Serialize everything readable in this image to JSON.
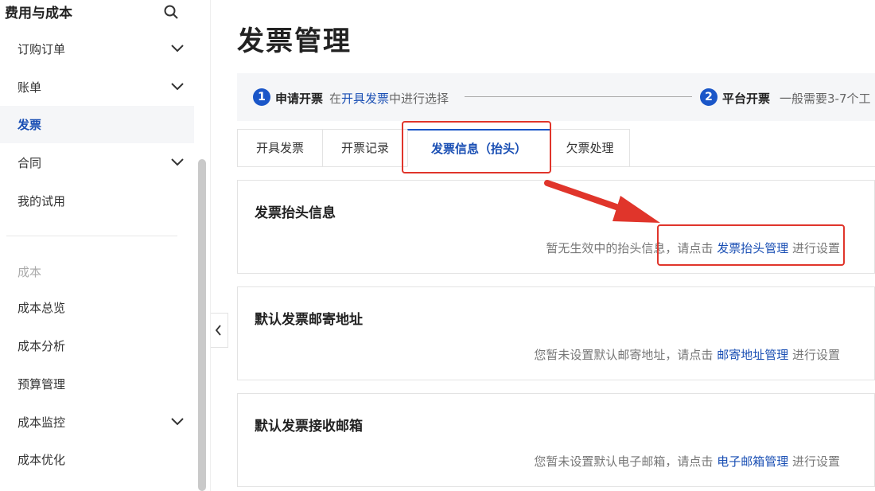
{
  "sidebar": {
    "title": "费用与成本",
    "items": [
      {
        "label": "订购订单"
      },
      {
        "label": "账单"
      },
      {
        "label": "发票"
      },
      {
        "label": "合同"
      },
      {
        "label": "我的试用"
      }
    ],
    "section_label": "成本",
    "section_items": [
      {
        "label": "成本总览"
      },
      {
        "label": "成本分析"
      },
      {
        "label": "预算管理"
      },
      {
        "label": "成本监控"
      },
      {
        "label": "成本优化"
      }
    ]
  },
  "page": {
    "title": "发票管理"
  },
  "steps": [
    {
      "num": "1",
      "title": "申请开票",
      "desc_pre": "在",
      "desc_link": "开具发票",
      "desc_post": "中进行选择"
    },
    {
      "num": "2",
      "title": "平台开票",
      "desc": "一般需要3-7个工"
    }
  ],
  "tabs": [
    {
      "label": "开具发票"
    },
    {
      "label": "开票记录"
    },
    {
      "label": "发票信息（抬头）"
    },
    {
      "label": "欠票处理"
    }
  ],
  "cards": [
    {
      "title": "发票抬头信息",
      "msg_pre": "暂无生效中的抬头信息，请点击 ",
      "link": "发票抬头管理",
      "msg_post": " 进行设置"
    },
    {
      "title": "默认发票邮寄地址",
      "msg_pre": "您暂未设置默认邮寄地址，请点击 ",
      "link": "邮寄地址管理",
      "msg_post": " 进行设置"
    },
    {
      "title": "默认发票接收邮箱",
      "msg_pre": "您暂未设置默认电子邮箱，请点击 ",
      "link": "电子邮箱管理",
      "msg_post": " 进行设置"
    }
  ],
  "colors": {
    "accent": "#1a56c8",
    "annotation": "#e0352b"
  }
}
